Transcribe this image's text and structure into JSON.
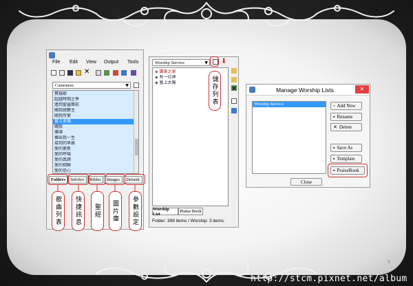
{
  "watermark": "http://stcm.pixnet.net/album",
  "slide_number": "9",
  "colors": {
    "accent_red": "#d03030",
    "selection_blue": "#3399ff"
  },
  "left_window": {
    "menu": [
      "File",
      "Edit",
      "View",
      "Output",
      "Tools"
    ],
    "language_select": "Cantonese",
    "songs": [
      "賛揚歌",
      "超越時間之爭",
      "遙到聖靈面前",
      "賜我脱麒主",
      "賜我所愛",
      "嘗上太陽",
      "賜我",
      "傳頌",
      "揀出我一生",
      "接到的早晨",
      "愛的更新",
      "愛的呼喚",
      "愛的真諦",
      "愛的相聯",
      "愛的信心"
    ],
    "selected_song_index": 5,
    "tabs": [
      "Folders",
      "InfoScr",
      "Bibles",
      "Images",
      "Default"
    ],
    "icons": [
      "new-file-icon",
      "open-icon",
      "save-icon",
      "folder-icon",
      "delete-icon",
      "print-icon",
      "settings-icon",
      "export-icon",
      "refresh-icon",
      "help-icon"
    ]
  },
  "middle_window": {
    "service_select": "Worship Service",
    "items": [
      "讚美之泉",
      "有一位神",
      "嘗上太陽"
    ],
    "tabs": [
      "Worship List",
      "Praise Book"
    ],
    "status": "Folder: 399 items / Worship: 3 items."
  },
  "right_window": {
    "title": "Manage Worship Lists",
    "list_items": [
      "Worship Service"
    ],
    "buttons": [
      "Add New",
      "Rename",
      "Delete",
      "Save As",
      "Template",
      "PraiseBook"
    ],
    "close_label": "Close"
  },
  "callouts": {
    "folders": "歌曲列表",
    "infoscr": "快捷訊息",
    "bibles": "聖經",
    "images": "圖片庫",
    "default": "參數設定",
    "save_list": "儲存列表"
  }
}
